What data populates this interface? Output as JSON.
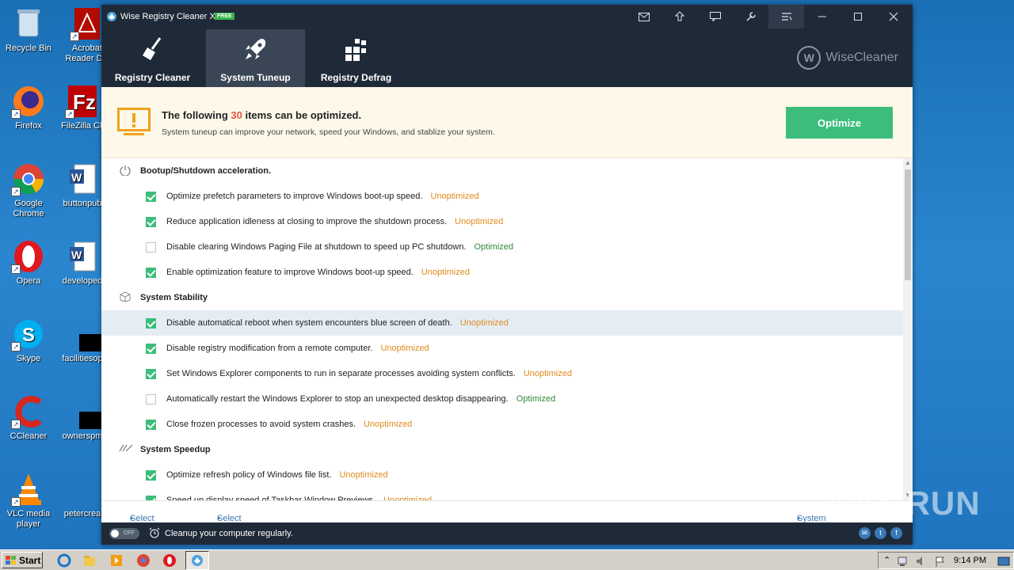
{
  "desktop": {
    "icons": [
      {
        "label": "Recycle Bin"
      },
      {
        "label": "Acrobat Reader DC"
      },
      {
        "label": "Firefox"
      },
      {
        "label": "FileZilla Cli"
      },
      {
        "label": "Google Chrome"
      },
      {
        "label": "buttonpub"
      },
      {
        "label": "Opera"
      },
      {
        "label": "developed"
      },
      {
        "label": "Skype"
      },
      {
        "label": "facilitiesop"
      },
      {
        "label": "CCleaner"
      },
      {
        "label": "ownerspm"
      },
      {
        "label": "VLC media player"
      },
      {
        "label": "petercrea"
      }
    ]
  },
  "app": {
    "title": "Wise Registry Cleaner X",
    "badge": "FREE",
    "brand": "WiseCleaner",
    "brand_mark": "W",
    "tabs": [
      {
        "label": "Registry Cleaner",
        "icon": "broom-icon"
      },
      {
        "label": "System Tuneup",
        "icon": "rocket-icon",
        "active": true
      },
      {
        "label": "Registry Defrag",
        "icon": "defrag-blocks-icon"
      }
    ],
    "banner": {
      "title_prefix": "The following ",
      "count": "30",
      "title_suffix": " items can be optimized.",
      "subtitle": "System tuneup can improve your network, speed your Windows, and stablize your system.",
      "button": "Optimize"
    },
    "sections": [
      {
        "title": "Bootup/Shutdown acceleration.",
        "icon": "power-icon",
        "items": [
          {
            "text": "Optimize prefetch parameters to improve Windows boot-up speed.",
            "status": "Unoptimized",
            "checked": true
          },
          {
            "text": "Reduce application idleness at closing to improve the shutdown process.",
            "status": "Unoptimized",
            "checked": true
          },
          {
            "text": "Disable clearing Windows Paging File at shutdown to speed up PC shutdown.",
            "status": "Optimized",
            "checked": false
          },
          {
            "text": "Enable optimization feature to improve Windows boot-up speed.",
            "status": "Unoptimized",
            "checked": true
          }
        ]
      },
      {
        "title": "System Stability",
        "icon": "cube-icon",
        "items": [
          {
            "text": "Disable automatical reboot when system encounters blue screen of death.",
            "status": "Unoptimized",
            "checked": true
          },
          {
            "text": "Disable registry modification from a remote computer.",
            "status": "Unoptimized",
            "checked": true
          },
          {
            "text": "Set Windows Explorer components to run in separate processes avoiding system conflicts.",
            "status": "Unoptimized",
            "checked": true
          },
          {
            "text": "Automatically restart the Windows Explorer to stop an unexpected desktop disappearing.",
            "status": "Optimized",
            "checked": false
          },
          {
            "text": "Close frozen processes to avoid system crashes.",
            "status": "Unoptimized",
            "checked": true
          }
        ]
      },
      {
        "title": "System Speedup",
        "icon": "speed-icon",
        "items": [
          {
            "text": "Optimize refresh policy of Windows file list.",
            "status": "Unoptimized",
            "checked": true
          },
          {
            "text": "Speed up display speed of Taskbar Window Previews.",
            "status": "Unoptimized",
            "checked": true
          }
        ]
      }
    ],
    "footer": {
      "select_all": "Select All",
      "select_none": "Select None",
      "system_default": "System Default"
    },
    "statusbar": {
      "toggle": "OFF",
      "text": "Cleanup your computer regularly."
    }
  },
  "taskbar": {
    "start": "Start",
    "clock": "9:14 PM"
  },
  "watermark": "ANY RUN",
  "colors": {
    "accent_green": "#3cbd7c",
    "unoptimized": "#e08a1c",
    "optimized": "#2e8b3a",
    "titlebar": "#1f2a38",
    "count_red": "#e8523f"
  }
}
